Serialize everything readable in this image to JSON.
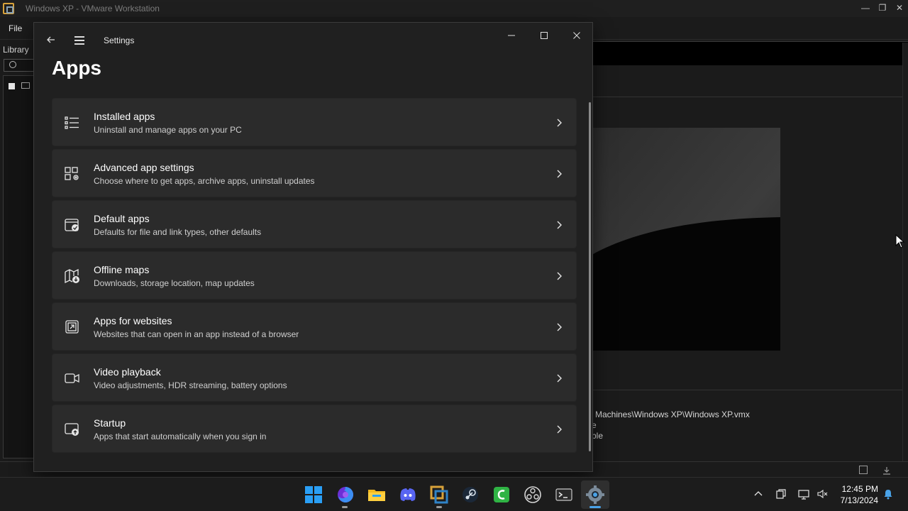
{
  "vmware": {
    "title": "Windows XP - VMware Workstation",
    "menu_file": "File",
    "library_label": "Library",
    "vm_path": "Machines\\Windows XP\\Windows XP.vmx",
    "fragment_1": "e",
    "fragment_2": "ble",
    "controls": {
      "minimize": "—",
      "restore": "❐",
      "close": "✕"
    }
  },
  "settings": {
    "window_title": "Settings",
    "page_title": "Apps",
    "items": [
      {
        "title": "Installed apps",
        "description": "Uninstall and manage apps on your PC",
        "icon": "installed-apps-icon"
      },
      {
        "title": "Advanced app settings",
        "description": "Choose where to get apps, archive apps, uninstall updates",
        "icon": "advanced-app-settings-icon"
      },
      {
        "title": "Default apps",
        "description": "Defaults for file and link types, other defaults",
        "icon": "default-apps-icon"
      },
      {
        "title": "Offline maps",
        "description": "Downloads, storage location, map updates",
        "icon": "offline-maps-icon"
      },
      {
        "title": "Apps for websites",
        "description": "Websites that can open in an app instead of a browser",
        "icon": "apps-for-websites-icon"
      },
      {
        "title": "Video playback",
        "description": "Video adjustments, HDR streaming, battery options",
        "icon": "video-playback-icon"
      },
      {
        "title": "Startup",
        "description": "Apps that start automatically when you sign in",
        "icon": "startup-icon"
      }
    ]
  },
  "taskbar": {
    "apps": [
      "start-icon",
      "firefox-icon",
      "file-explorer-icon",
      "discord-icon",
      "vmware-icon",
      "steam-icon",
      "camtasia-icon",
      "obs-icon",
      "terminal-icon",
      "settings-icon"
    ],
    "active_app": "settings-icon",
    "time": "12:45 PM",
    "date": "7/13/2024"
  },
  "colors": {
    "settings_bg": "#202020",
    "card_bg": "#2b2b2b",
    "taskbar_bg": "#1c1c1c",
    "windows_blue": "#2a9ff5",
    "vmware_orange": "#d8a23a"
  }
}
